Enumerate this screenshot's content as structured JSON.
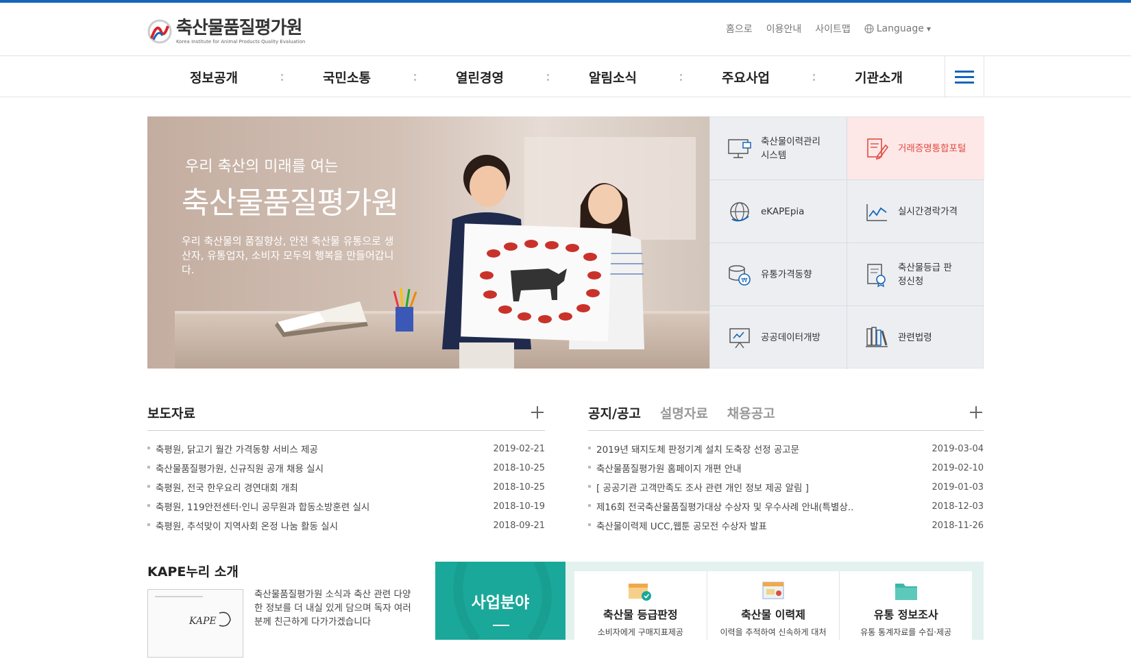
{
  "header": {
    "logo_ko": "축산물품질평가원",
    "logo_en": "Korea Institute for Animal Products Quality Evaluation",
    "util": {
      "home": "홈으로",
      "guide": "이용안내",
      "sitemap": "사이트맵",
      "language": "Language"
    }
  },
  "gnb": [
    "정보공개",
    "국민소통",
    "열린경영",
    "알림소식",
    "주요사업",
    "기관소개"
  ],
  "hero": {
    "subtitle": "우리 축산의 미래를 여는",
    "title": "축산물품질평가원",
    "desc": "우리 축산물의 품질향상, 안전 축산물 유통으로 생산자, 유통업자, 소비자 모두의 행복을 만들어갑니다."
  },
  "quick": [
    {
      "label": "축산물이력관리 시스템",
      "icon": "monitor-icon"
    },
    {
      "label": "거래증명통합포털",
      "icon": "document-pen-icon"
    },
    {
      "label": "eKAPEpia",
      "icon": "globe-icon"
    },
    {
      "label": "실시간경락가격",
      "icon": "chart-line-icon"
    },
    {
      "label": "유통가격동향",
      "icon": "coins-icon"
    },
    {
      "label": "축산물등급 판정신청",
      "icon": "certificate-icon"
    },
    {
      "label": "공공데이터개방",
      "icon": "presentation-icon"
    },
    {
      "label": "관련법령",
      "icon": "books-icon"
    }
  ],
  "press": {
    "title": "보도자료",
    "items": [
      {
        "title": "축평원, 닭고기 월간 가격동향 서비스 제공",
        "date": "2019-02-21"
      },
      {
        "title": "축산물품질평가원, 신규직원 공개 채용 실시",
        "date": "2018-10-25"
      },
      {
        "title": "축평원, 전국 한우요리 경연대회 개최",
        "date": "2018-10-25"
      },
      {
        "title": "축평원, 119안전센터·인니 공무원과 합동소방훈련 실시",
        "date": "2018-10-19"
      },
      {
        "title": "축평원, 추석맞이 지역사회 온정 나눔 활동 실시",
        "date": "2018-09-21"
      }
    ]
  },
  "notice": {
    "tabs": [
      "공지/공고",
      "설명자료",
      "채용공고"
    ],
    "items": [
      {
        "title": "2019년 돼지도체 판정기계 설치 도축장 선정 공고문",
        "date": "2019-03-04"
      },
      {
        "title": "축산물품질평가원 홈페이지 개편 안내",
        "date": "2019-02-10"
      },
      {
        "title": "[ 공공기관 고객만족도 조사 관련 개인 정보 제공 알림 ]",
        "date": "2019-01-03"
      },
      {
        "title": "제16회 전국축산물품질평가대상 수상자 및 우수사례 안내(특별상..",
        "date": "2018-12-03"
      },
      {
        "title": "축산물이력제 UCC,웹툰 공모전 수상자 발표",
        "date": "2018-11-26"
      }
    ]
  },
  "kape": {
    "title": "KAPE누리 소개",
    "desc": "축산물품질평가원 소식과 축산 관련 다양한 정보를 더 내실 있게 담으며 독자 여러분께 친근하게 다가가겠습니다"
  },
  "business": {
    "label": "사업분야",
    "items": [
      {
        "name": "축산물 등급판정",
        "desc": "소비자에게 구매지표제공"
      },
      {
        "name": "축산물 이력제",
        "desc": "이력을 추적하여 신속하게 대처"
      },
      {
        "name": "유통 정보조사",
        "desc": "유통 통계자료를 수집·제공"
      }
    ]
  },
  "colors": {
    "primary": "#1466b8",
    "accent_red": "#e24a3f",
    "teal": "#1aa89a"
  }
}
